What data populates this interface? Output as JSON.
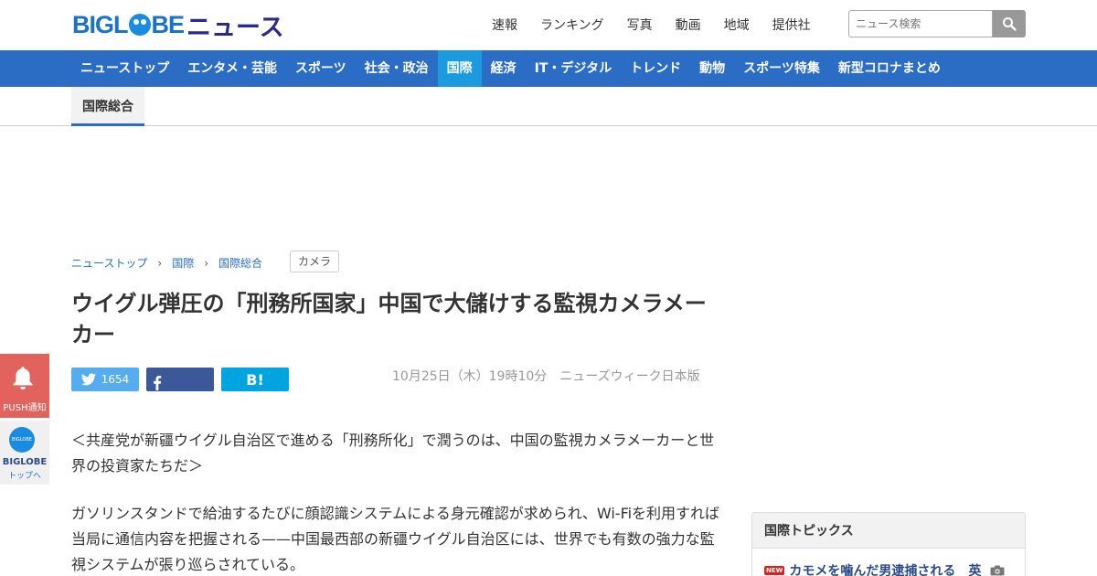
{
  "header": {
    "logo_latin_1": "BIGL",
    "logo_latin_2": "BE",
    "logo_kana": "ニュース",
    "links": [
      "速報",
      "ランキング",
      "写真",
      "動画",
      "地域",
      "提供社"
    ],
    "search_placeholder": "ニュース検索"
  },
  "nav": {
    "items": [
      "ニューストップ",
      "エンタメ・芸能",
      "スポーツ",
      "社会・政治",
      "国際",
      "経済",
      "IT・デジタル",
      "トレンド",
      "動物",
      "スポーツ特集",
      "新型コロナまとめ"
    ],
    "active_index": 4
  },
  "subnav": {
    "active_tab": "国際総合"
  },
  "breadcrumb": [
    "ニューストップ",
    "国際",
    "国際総合"
  ],
  "tag": "カメラ",
  "article": {
    "title": "ウイグル弾圧の「刑務所国家」中国で大儲けする監視カメラメーカー",
    "tweet_count": "1654",
    "hatena_label": "B!",
    "date": "10月25日（木）19時10分",
    "source": "ニューズウィーク日本版",
    "lead": "＜共産党が新疆ウイグル自治区で進める「刑務所化」で潤うのは、中国の監視カメラメーカーと世界の投資家たちだ＞",
    "body": "ガソリンスタンドで給油するたびに顔認識システムによる身元確認が求められ、Wi-Fiを利用すれば当局に通信内容を把握される——中国最西部の新疆ウイグル自治区には、世界でも有数の強力な監視システムが張り巡らされている。"
  },
  "side": {
    "push_label": "PUSH通知",
    "biglobe_icon_text": "BIGLOBE",
    "biglobe_label": "BIGLOBE",
    "biglobe_sub": "トップへ"
  },
  "topics": {
    "heading": "国際トピックス",
    "new_badge": "NEW",
    "item": "カモメを噛んだ男逮捕される　英"
  },
  "colors": {
    "brand": "#2b6cc4",
    "active_nav": "#1a9be0",
    "push": "#e2625e"
  }
}
